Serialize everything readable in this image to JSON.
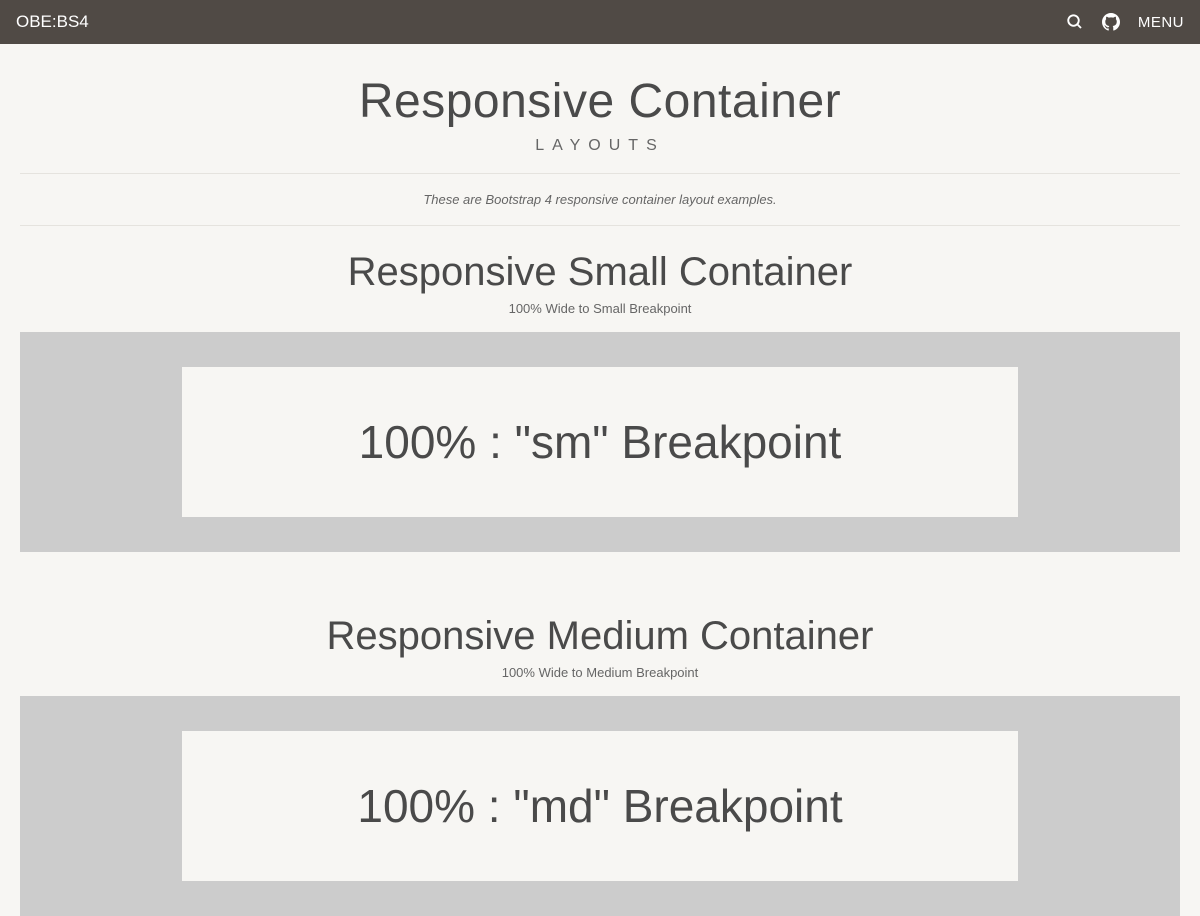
{
  "navbar": {
    "brand": "OBE:BS4",
    "menu_label": "MENU"
  },
  "page": {
    "title": "Responsive Container",
    "subtitle": "LAYOUTS",
    "description": "These are Bootstrap 4 responsive container layout examples."
  },
  "sections": [
    {
      "title": "Responsive Small Container",
      "subtitle": "100% Wide to Small Breakpoint",
      "example_text": "100% : \"sm\" Breakpoint"
    },
    {
      "title": "Responsive Medium Container",
      "subtitle": "100% Wide to Medium Breakpoint",
      "example_text": "100% : \"md\" Breakpoint"
    }
  ]
}
